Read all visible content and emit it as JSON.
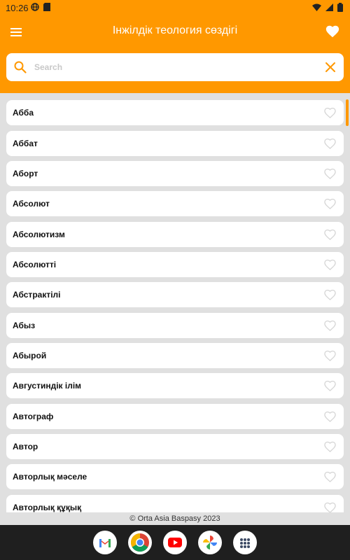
{
  "status_bar": {
    "time": "10:26"
  },
  "header": {
    "title": "Інжілдік теология сөздігі"
  },
  "search": {
    "placeholder": "Search",
    "value": ""
  },
  "list": {
    "items": [
      {
        "label": "Абба"
      },
      {
        "label": "Аббат"
      },
      {
        "label": "Аборт"
      },
      {
        "label": "Абсолют"
      },
      {
        "label": "Абсолютизм"
      },
      {
        "label": "Абсолютті"
      },
      {
        "label": "Абстрактілі"
      },
      {
        "label": "Абыз"
      },
      {
        "label": "Абырой"
      },
      {
        "label": "Августиндік ілім"
      },
      {
        "label": "Автограф"
      },
      {
        "label": "Автор"
      },
      {
        "label": "Авторлық мәселе"
      },
      {
        "label": "Авторлық құқық"
      }
    ]
  },
  "footer": {
    "text": "© Orta Asia Baspasy 2023"
  },
  "colors": {
    "accent": "#ff9800",
    "background": "#e0e0e0",
    "dock": "#1f1f1f"
  },
  "dock": {
    "apps": [
      "gmail-icon",
      "chrome-icon",
      "youtube-icon",
      "photos-icon",
      "app-drawer-icon"
    ]
  }
}
